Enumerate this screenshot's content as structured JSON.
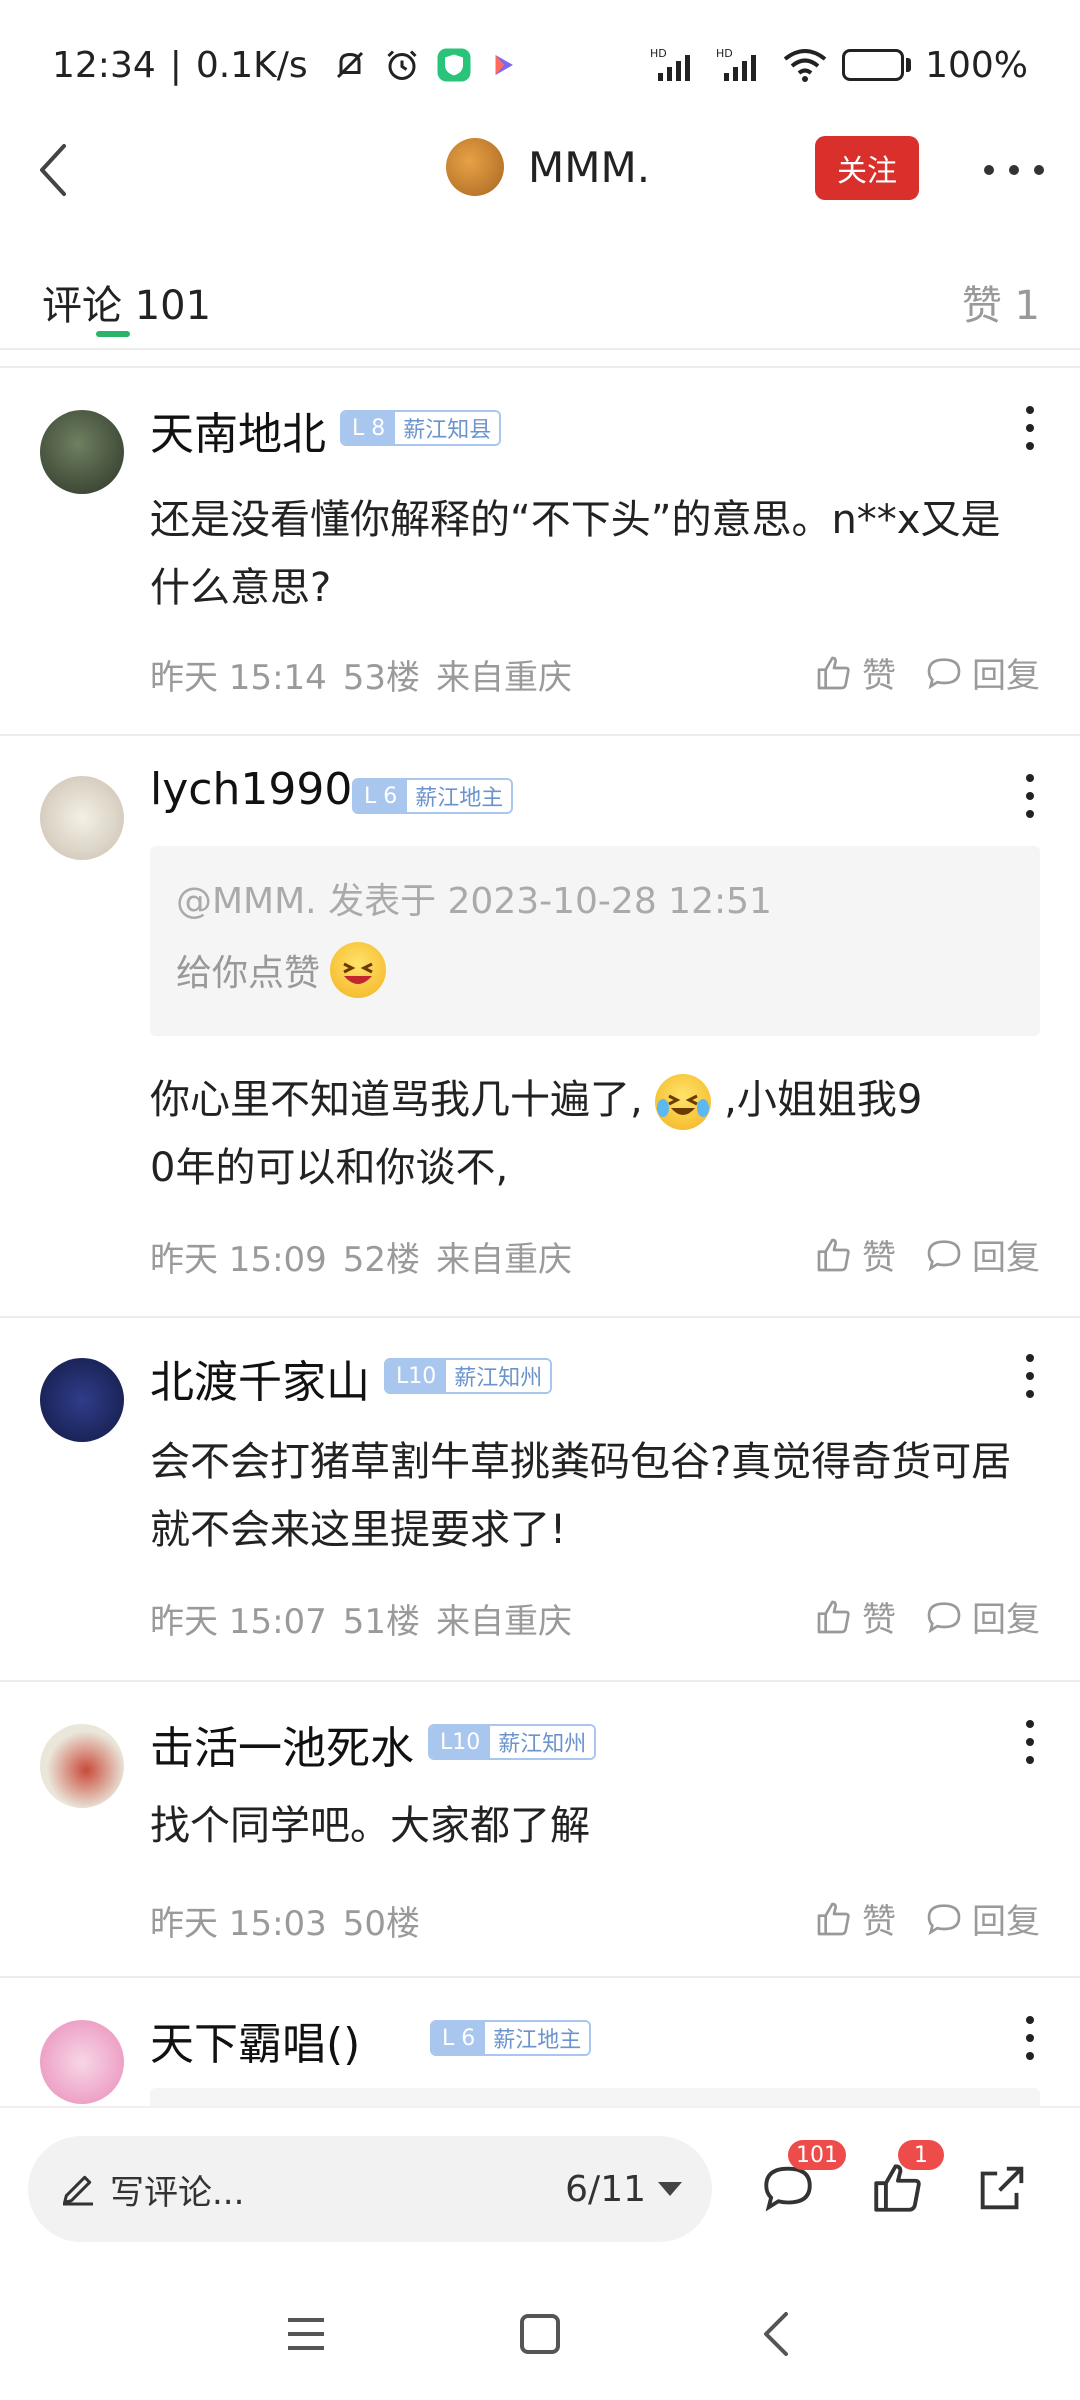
{
  "status_bar": {
    "time": "12:34",
    "network_speed": "0.1K/s",
    "battery": "100%",
    "battery_level": 1.0,
    "icons": [
      "mute-icon",
      "alarm-icon",
      "vpn-shield-icon",
      "play-icon",
      "hd-signal-icon",
      "hd-signal-icon",
      "wifi-icon",
      "battery-charging-icon"
    ],
    "hd_label": "HD"
  },
  "header": {
    "title": "MMM.",
    "follow_label": "关注",
    "accent_color": "#d9302c"
  },
  "tabs": {
    "comments_label": "评论",
    "comments_count": "101",
    "likes_label": "赞",
    "likes_count": "1"
  },
  "comments": [
    {
      "name": "天南地北",
      "level": "L 8",
      "rank": "薪江知县",
      "text": "还是没看懂你解释的“不下头”的意思。n**x又是什么意思?",
      "time": "昨天 15:14",
      "floor": "53楼",
      "location": "来自重庆",
      "like_label": "赞",
      "reply_label": "回复"
    },
    {
      "name": "lych1990",
      "level": "L 6",
      "rank": "薪江地主",
      "quote_head": "@MMM. 发表于 2023-10-28 12:51",
      "quote_text": "给你点赞",
      "text_a": "你心里不知道骂我几十遍了,",
      "text_b": ",小姐姐我9",
      "text_c": "0年的可以和你谈不,",
      "time": "昨天 15:09",
      "floor": "52楼",
      "location": "来自重庆",
      "like_label": "赞",
      "reply_label": "回复"
    },
    {
      "name": "北渡千家山",
      "level": "L10",
      "rank": "薪江知州",
      "text": "会不会打猪草割牛草挑粪码包谷?真觉得奇货可居就不会来这里提要求了!",
      "time": "昨天 15:07",
      "floor": "51楼",
      "location": "来自重庆",
      "like_label": "赞",
      "reply_label": "回复"
    },
    {
      "name": "击活一池死水",
      "level": "L10",
      "rank": "薪江知州",
      "text": "找个同学吧。大家都了解",
      "time": "昨天 15:03",
      "floor": "50楼",
      "like_label": "赞",
      "reply_label": "回复"
    },
    {
      "name": "天下霸唱()",
      "level": "L 6",
      "rank": "薪江地主"
    }
  ],
  "bottom_bar": {
    "write_placeholder": "写评论...",
    "page_indicator": "6/11",
    "comment_badge": "101",
    "like_badge": "1"
  }
}
